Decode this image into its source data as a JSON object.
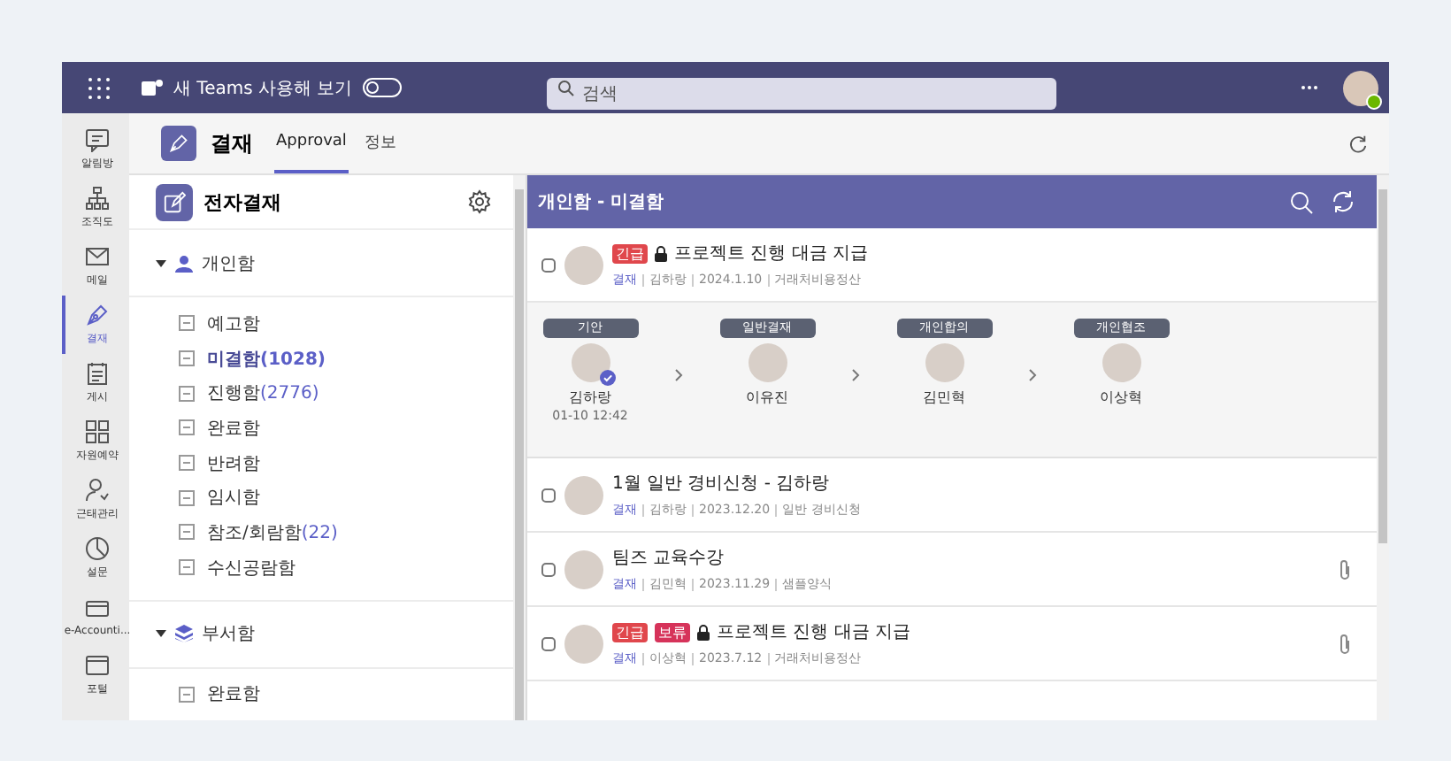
{
  "topbar": {
    "title": "새 Teams 사용해 보기",
    "toggle_on": false,
    "search_placeholder": "검색"
  },
  "rail": [
    {
      "label": "알림방",
      "kind": "chat",
      "selected": false
    },
    {
      "label": "조직도",
      "kind": "org",
      "selected": false
    },
    {
      "label": "메일",
      "kind": "mail",
      "selected": false
    },
    {
      "label": "결재",
      "kind": "pen",
      "selected": true
    },
    {
      "label": "게시",
      "kind": "calendar",
      "selected": false
    },
    {
      "label": "자원예약",
      "kind": "grid",
      "selected": false
    },
    {
      "label": "근태관리",
      "kind": "person",
      "selected": false
    },
    {
      "label": "설문",
      "kind": "pie",
      "selected": false
    },
    {
      "label": "e-Accounti...",
      "kind": "card",
      "selected": false
    },
    {
      "label": "포털",
      "kind": "window",
      "selected": false
    }
  ],
  "app": {
    "title": "결재",
    "tabs": [
      {
        "label": "Approval",
        "selected": true
      },
      {
        "label": "정보",
        "selected": false
      }
    ]
  },
  "sidebar": {
    "title": "전자결재",
    "sections": [
      {
        "label": "개인함",
        "kind": "person",
        "expanded": true,
        "children": [
          {
            "label": "예고함",
            "selected": false
          },
          {
            "label": "미결함",
            "count": "(1028)",
            "selected": true
          },
          {
            "label": "진행함",
            "count": "(2776)",
            "selected": false
          },
          {
            "label": "완료함",
            "selected": false
          },
          {
            "label": "반려함",
            "selected": false
          },
          {
            "label": "임시함",
            "selected": false
          },
          {
            "label": "참조/회람함",
            "count": "(22)",
            "selected": false
          },
          {
            "label": "수신공람함",
            "selected": false
          }
        ]
      },
      {
        "label": "부서함",
        "kind": "stack",
        "expanded": true,
        "children": [
          {
            "label": "완료함",
            "selected": false
          }
        ]
      }
    ]
  },
  "list": {
    "title": "개인함 - 미결함",
    "items": [
      {
        "checked": false,
        "badges": [
          {
            "label": "긴급",
            "kind": "urgent"
          }
        ],
        "locked": true,
        "title": "프로젝트 진행 대금 지급",
        "meta": [
          "결재",
          "김하랑",
          "2024.1.10",
          "거래처비용정산"
        ],
        "attachment": false,
        "approval_line": [
          {
            "role": "기안",
            "name": "김하랑",
            "time": "01-10 12:42",
            "approved": true
          },
          {
            "role": "일반결재",
            "name": "이유진",
            "approved": false
          },
          {
            "role": "개인합의",
            "name": "김민혁",
            "approved": false
          },
          {
            "role": "개인협조",
            "name": "이상혁",
            "approved": false
          }
        ]
      },
      {
        "checked": false,
        "locked": false,
        "title": "1월 일반 경비신청 - 김하랑",
        "meta": [
          "결재",
          "김하랑",
          "2023.12.20",
          "일반 경비신청"
        ],
        "attachment": false
      },
      {
        "checked": false,
        "locked": false,
        "title": "팀즈 교육수강",
        "meta": [
          "결재",
          "김민혁",
          "2023.11.29",
          "샘플양식"
        ],
        "attachment": true
      },
      {
        "checked": false,
        "badges": [
          {
            "label": "긴급",
            "kind": "urgent"
          },
          {
            "label": "보류",
            "kind": "hold"
          }
        ],
        "locked": true,
        "title": "프로젝트 진행 대금 지급",
        "meta": [
          "결재",
          "이상혁",
          "2023.7.12",
          "거래처비용정산"
        ],
        "attachment": true
      }
    ]
  }
}
